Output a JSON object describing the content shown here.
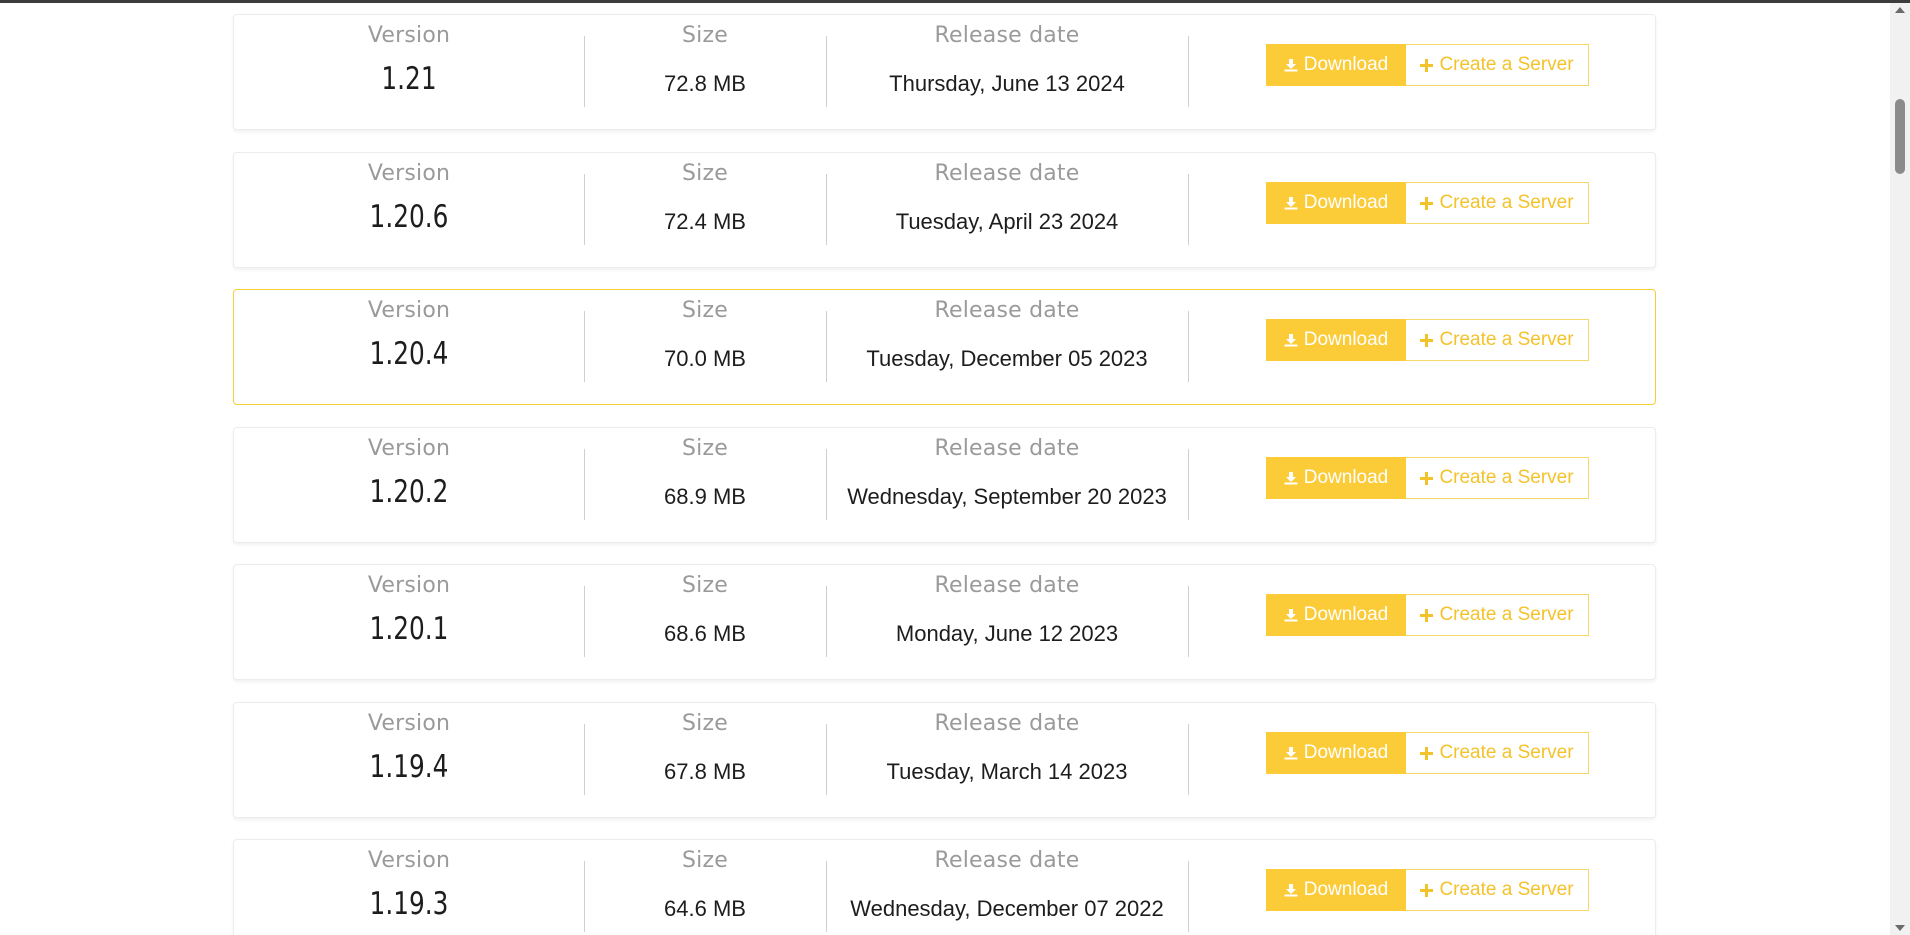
{
  "labels": {
    "version": "Version",
    "size": "Size",
    "release_date": "Release date",
    "download": "Download",
    "create_server": "Create a Server"
  },
  "colors": {
    "accent": "#fbcb38",
    "accent_text": "#f4c22a",
    "highlight_border": "#f5cf3a"
  },
  "icons": {
    "download": "download-icon",
    "create": "plus-icon"
  },
  "releases": [
    {
      "version": "1.21",
      "size": "72.8 MB",
      "date": "Thursday, June 13 2024",
      "highlighted": false
    },
    {
      "version": "1.20.6",
      "size": "72.4 MB",
      "date": "Tuesday, April 23 2024",
      "highlighted": false
    },
    {
      "version": "1.20.4",
      "size": "70.0 MB",
      "date": "Tuesday, December 05 2023",
      "highlighted": true
    },
    {
      "version": "1.20.2",
      "size": "68.9 MB",
      "date": "Wednesday, September 20 2023",
      "highlighted": false
    },
    {
      "version": "1.20.1",
      "size": "68.6 MB",
      "date": "Monday, June 12 2023",
      "highlighted": false
    },
    {
      "version": "1.19.4",
      "size": "67.8 MB",
      "date": "Tuesday, March 14 2023",
      "highlighted": false
    },
    {
      "version": "1.19.3",
      "size": "64.6 MB",
      "date": "Wednesday, December 07 2022",
      "highlighted": false
    }
  ]
}
